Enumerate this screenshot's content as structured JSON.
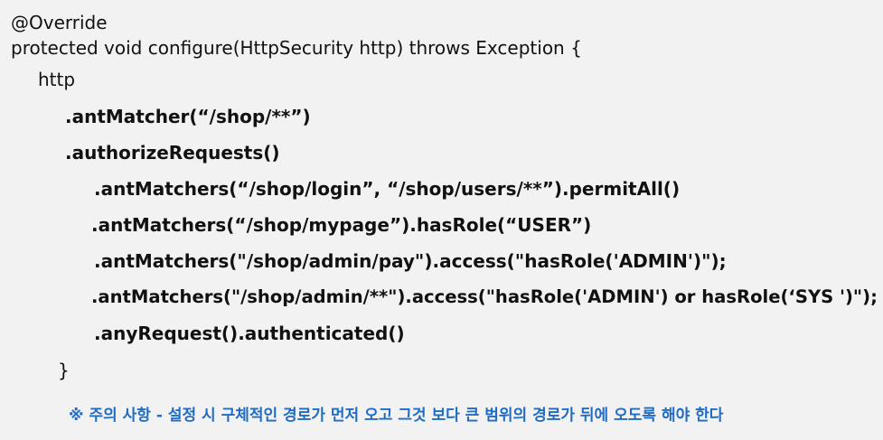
{
  "code": {
    "line1": "@Override",
    "line2": "protected void configure(HttpSecurity http) throws Exception {",
    "line3": "http",
    "line4": ".antMatcher(“/shop/**”)",
    "line5": ".authorizeRequests()",
    "line6": ".antMatchers(“/shop/login”, “/shop/users/**”).permitAll()",
    "line7": ".antMatchers(“/shop/mypage”).hasRole(“USER”)",
    "line8": ".antMatchers(\"/shop/admin/pay\").access(\"hasRole('ADMIN')\");",
    "line9": ".antMatchers(\"/shop/admin/**\").access(\"hasRole('ADMIN') or hasRole(‘SYS ')\");",
    "line10": ".anyRequest().authenticated()",
    "line11": "}"
  },
  "note": {
    "text": "※ 주의 사항 - 설정 시 구체적인 경로가 먼저 오고 그것 보다 큰 범위의 경로가 뒤에 오도록 해야 한다",
    "color": "#1f6cc4"
  }
}
